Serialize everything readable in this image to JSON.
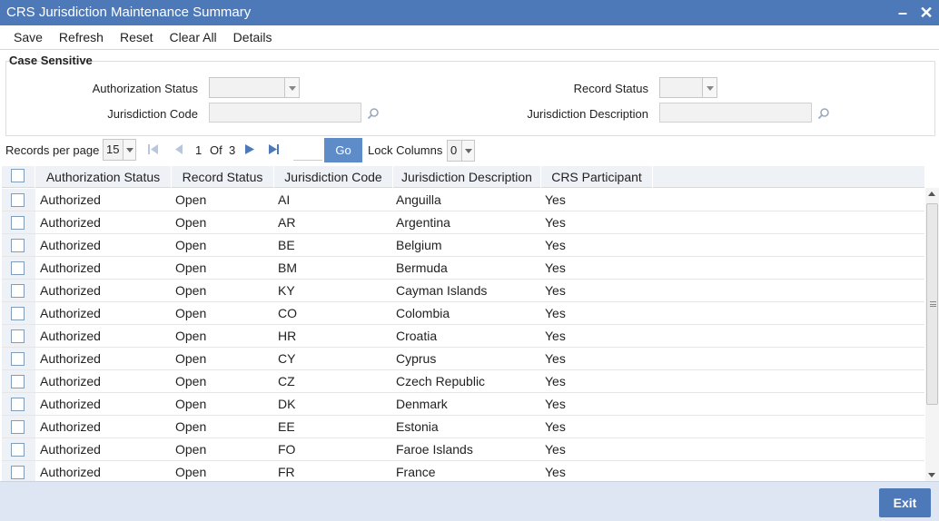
{
  "window": {
    "title": "CRS Jurisdiction Maintenance Summary"
  },
  "toolbar": [
    "Save",
    "Refresh",
    "Reset",
    "Clear All",
    "Details"
  ],
  "criteria": {
    "legend": "Case Sensitive",
    "authorization_status_label": "Authorization Status",
    "authorization_status_value": "",
    "record_status_label": "Record Status",
    "record_status_value": "",
    "jurisdiction_code_label": "Jurisdiction Code",
    "jurisdiction_code_value": "",
    "jurisdiction_description_label": "Jurisdiction Description",
    "jurisdiction_description_value": ""
  },
  "pager": {
    "records_per_page_label": "Records per page",
    "records_per_page_value": "15",
    "current_page": "1",
    "of_label": "Of",
    "total_pages": "3",
    "go_label": "Go",
    "lock_columns_label": "Lock Columns",
    "lock_columns_value": "0"
  },
  "grid": {
    "columns": [
      "Authorization Status",
      "Record Status",
      "Jurisdiction Code",
      "Jurisdiction Description",
      "CRS Participant"
    ],
    "rows": [
      [
        "Authorized",
        "Open",
        "AI",
        "Anguilla",
        "Yes"
      ],
      [
        "Authorized",
        "Open",
        "AR",
        "Argentina",
        "Yes"
      ],
      [
        "Authorized",
        "Open",
        "BE",
        "Belgium",
        "Yes"
      ],
      [
        "Authorized",
        "Open",
        "BM",
        "Bermuda",
        "Yes"
      ],
      [
        "Authorized",
        "Open",
        "KY",
        "Cayman Islands",
        "Yes"
      ],
      [
        "Authorized",
        "Open",
        "CO",
        "Colombia",
        "Yes"
      ],
      [
        "Authorized",
        "Open",
        "HR",
        "Croatia",
        "Yes"
      ],
      [
        "Authorized",
        "Open",
        "CY",
        "Cyprus",
        "Yes"
      ],
      [
        "Authorized",
        "Open",
        "CZ",
        "Czech Republic",
        "Yes"
      ],
      [
        "Authorized",
        "Open",
        "DK",
        "Denmark",
        "Yes"
      ],
      [
        "Authorized",
        "Open",
        "EE",
        "Estonia",
        "Yes"
      ],
      [
        "Authorized",
        "Open",
        "FO",
        "Faroe Islands",
        "Yes"
      ],
      [
        "Authorized",
        "Open",
        "FR",
        "France",
        "Yes"
      ]
    ]
  },
  "footer": {
    "exit_label": "Exit"
  },
  "icons": {
    "minimize": "minimize-icon",
    "close": "close-icon",
    "search": "search-icon",
    "first_page": "first-page-icon",
    "prev_page": "prev-page-icon",
    "next_page": "next-page-icon",
    "last_page": "last-page-icon"
  },
  "colors": {
    "titlebar": "#4d79b8",
    "go_button": "#5e8cc9",
    "footer": "#dde6f2",
    "header_row": "#eef1f5"
  }
}
